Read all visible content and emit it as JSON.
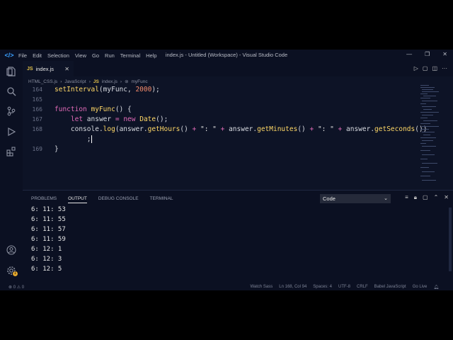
{
  "titlebar": {
    "menu": [
      "File",
      "Edit",
      "Selection",
      "View",
      "Go",
      "Run",
      "Terminal",
      "Help"
    ],
    "title": "index.js - Untitled (Workspace) - Visual Studio Code"
  },
  "tab": {
    "icon_label": "JS",
    "name": "index.js"
  },
  "breadcrumb": {
    "part1": "HTML_CSS.js",
    "part2": "JavaScript",
    "js": "JS",
    "part3": "index.js",
    "part4": "myFunc"
  },
  "code": {
    "lines": [
      {
        "n": "164",
        "t1": "setInterval",
        "t2": "(",
        "t3": "myFunc",
        "t4": ", ",
        "t5": "2000",
        "t6": ");"
      },
      {
        "n": "165"
      },
      {
        "n": "166",
        "kw": "function",
        "fn": "myFunc",
        "rest": "() {"
      },
      {
        "n": "167",
        "kw": "let",
        "id": "answer",
        "eq": "=",
        "new": "new",
        "cls": "Date",
        "rest": "();"
      },
      {
        "n": "168",
        "obj": "console",
        "dot": ".",
        "m": "log",
        "a": "(answer.",
        "g1": "getHours",
        "p1": "() ",
        "pl1": "+",
        "s1": " \": \" ",
        "pl2": "+",
        "a2": " answer.",
        "g2": "getMinutes",
        "p2": "() ",
        "pl3": "+",
        "s2": " \": \" ",
        "pl4": "+",
        "a3": " answer.",
        "g3": "getSeconds",
        "p3": "())"
      },
      {
        "n": "",
        "semi": ";"
      },
      {
        "n": "169",
        "brace": "}"
      }
    ]
  },
  "panel": {
    "tabs": [
      "PROBLEMS",
      "OUTPUT",
      "DEBUG CONSOLE",
      "TERMINAL"
    ],
    "select": "Code",
    "output": [
      "6: 11: 53",
      "6: 11: 55",
      "6: 11: 57",
      "6: 11: 59",
      "6: 12: 1",
      "6: 12: 3",
      "6: 12: 5"
    ]
  },
  "status": {
    "left": "⊗ 0 ⚠ 0",
    "items": [
      "Watch Sass",
      "Ln 168, Col 94",
      "Spaces: 4",
      "UTF-8",
      "CRLF",
      "Babel JavaScript",
      "Go Live"
    ]
  },
  "gear_badge": "1"
}
